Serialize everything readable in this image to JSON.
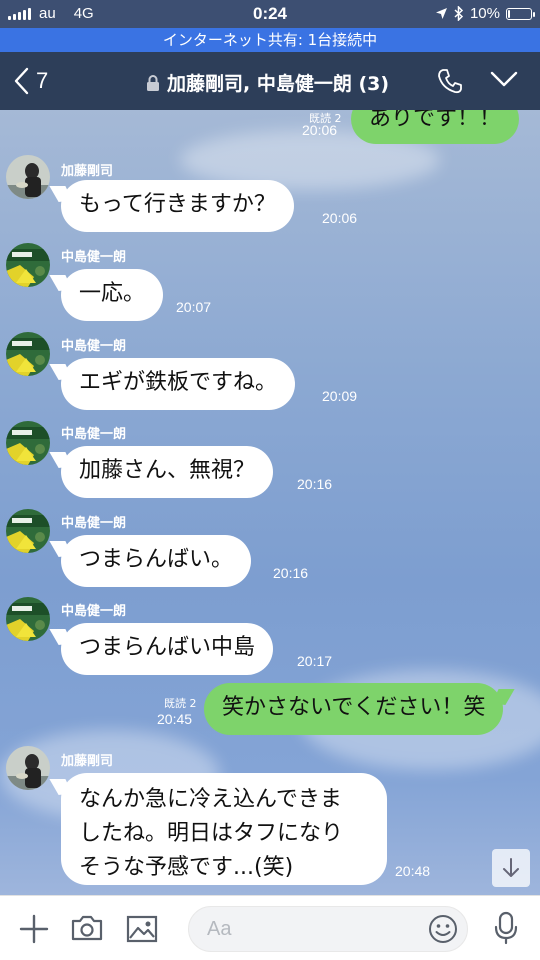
{
  "status_bar": {
    "carrier": "au",
    "network": "4G",
    "time": "0:24",
    "battery": "10%",
    "battery_level": 0.1
  },
  "tether_bar": {
    "text": "インターネット共有: 1台接続中"
  },
  "header": {
    "back_count": "7",
    "title": "加藤剛司, 中島健一朗 (3)"
  },
  "messages": [
    {
      "direction": "out",
      "text": "ありです！！",
      "time": "20:06",
      "read": "既読 2"
    },
    {
      "direction": "in",
      "sender": "加藤剛司",
      "text": "もって行きますか？",
      "time": "20:06"
    },
    {
      "direction": "in",
      "sender": "中島健一朗",
      "text": "一応。",
      "time": "20:07"
    },
    {
      "direction": "in",
      "sender": "中島健一朗",
      "text": "エギが鉄板ですね。",
      "time": "20:09"
    },
    {
      "direction": "in",
      "sender": "中島健一朗",
      "text": "加藤さん、無視？",
      "time": "20:16"
    },
    {
      "direction": "in",
      "sender": "中島健一朗",
      "text": "つまらんばい。",
      "time": "20:16"
    },
    {
      "direction": "in",
      "sender": "中島健一朗",
      "text": "つまらんばい中島",
      "time": "20:17"
    },
    {
      "direction": "out",
      "text": "笑かさないでください！笑",
      "time": "20:45",
      "read": "既読 2"
    },
    {
      "direction": "in",
      "sender": "加藤剛司",
      "lines": [
        "なんか急に冷え込んできま",
        "したね。明日はタフになり",
        "そうな予感です...(笑)"
      ],
      "time": "20:48"
    }
  ],
  "input": {
    "placeholder": "Aa"
  },
  "colors": {
    "header": "#2d3e59",
    "tether": "#3a73e3",
    "out_bubble": "#7ed36b",
    "in_bubble": "#ffffff"
  },
  "icons": [
    "signal-icon",
    "location-icon",
    "bluetooth-icon",
    "battery-icon",
    "back-chevron-icon",
    "lock-icon",
    "phone-icon",
    "chevron-down-icon",
    "arrow-down-icon",
    "plus-icon",
    "camera-icon",
    "image-icon",
    "emoji-icon",
    "microphone-icon"
  ]
}
